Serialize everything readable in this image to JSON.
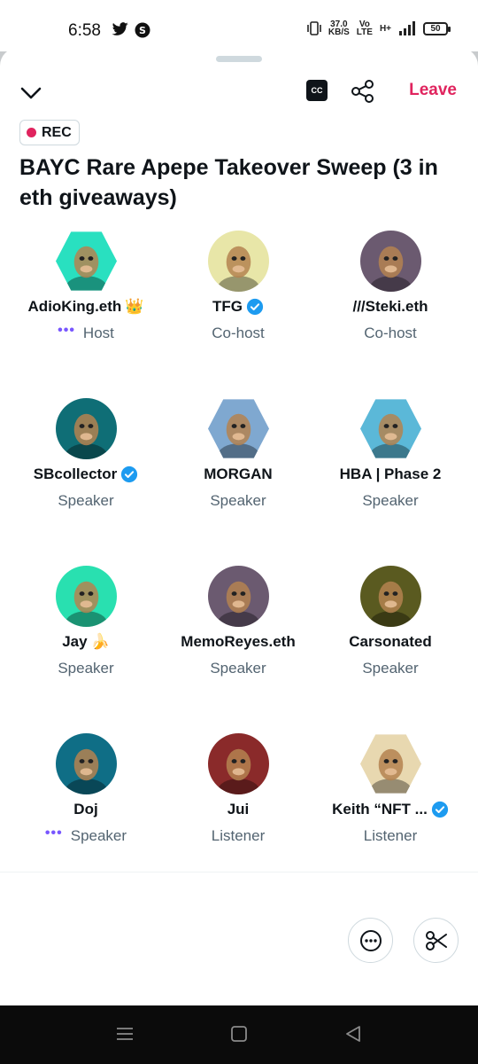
{
  "status_bar": {
    "time": "6:58",
    "speed_value": "37.0",
    "speed_unit": "KB/S",
    "volte_top": "Vo",
    "volte_bottom": "LTE",
    "network": "H+",
    "battery": "50"
  },
  "header": {
    "cc_label": "CC",
    "leave_label": "Leave"
  },
  "rec_badge": "REC",
  "title": "BAYC Rare Apepe Takeover Sweep (3 in eth giveaways)",
  "participants": [
    {
      "name": "AdioKing.eth",
      "badge": "👑",
      "verified": false,
      "role": "Host",
      "talking": true,
      "shape": "hex",
      "bg": "#29e0c0"
    },
    {
      "name": "TFG",
      "badge": "",
      "verified": true,
      "role": "Co-host",
      "talking": false,
      "shape": "circle",
      "bg": "#e8e6a8"
    },
    {
      "name": "///Steki.eth",
      "badge": "",
      "verified": false,
      "role": "Co-host",
      "talking": false,
      "shape": "circle",
      "bg": "#6b5a70"
    },
    {
      "name": "SBcollector",
      "badge": "",
      "verified": true,
      "role": "Speaker",
      "talking": false,
      "shape": "circle",
      "bg": "#0f6e76"
    },
    {
      "name": "MORGAN",
      "badge": "",
      "verified": false,
      "role": "Speaker",
      "talking": false,
      "shape": "hex",
      "bg": "#7fa8d0"
    },
    {
      "name": "HBA | Phase 2",
      "badge": "",
      "verified": false,
      "role": "Speaker",
      "talking": false,
      "shape": "hex",
      "bg": "#5bb8d8"
    },
    {
      "name": "Jay",
      "badge": "🍌",
      "verified": false,
      "role": "Speaker",
      "talking": false,
      "shape": "circle",
      "bg": "#29e0b0"
    },
    {
      "name": "MemoReyes.eth",
      "badge": "",
      "verified": false,
      "role": "Speaker",
      "talking": false,
      "shape": "circle",
      "bg": "#6b5a70"
    },
    {
      "name": "Carsonated",
      "badge": "",
      "verified": false,
      "role": "Speaker",
      "talking": false,
      "shape": "circle",
      "bg": "#5a5a20"
    },
    {
      "name": "Doj",
      "badge": "",
      "verified": false,
      "role": "Speaker",
      "talking": true,
      "shape": "circle",
      "bg": "#0f6e86"
    },
    {
      "name": "Jui",
      "badge": "",
      "verified": false,
      "role": "Listener",
      "talking": false,
      "shape": "circle",
      "bg": "#8a2a2a"
    },
    {
      "name": "Keith “NFT ...",
      "badge": "",
      "verified": true,
      "role": "Listener",
      "talking": false,
      "shape": "hex",
      "bg": "#e8d8b0"
    }
  ],
  "icons": {
    "collapse": "chevron-down-icon",
    "captions": "captions-icon",
    "share": "share-icon",
    "more": "more-icon",
    "clip": "scissors-icon",
    "verified": "verified-badge-icon"
  },
  "colors": {
    "accent_red": "#e0245e",
    "verified_blue": "#1d9bf0",
    "talking_purple": "#7856ff",
    "secondary_text": "#536471"
  }
}
